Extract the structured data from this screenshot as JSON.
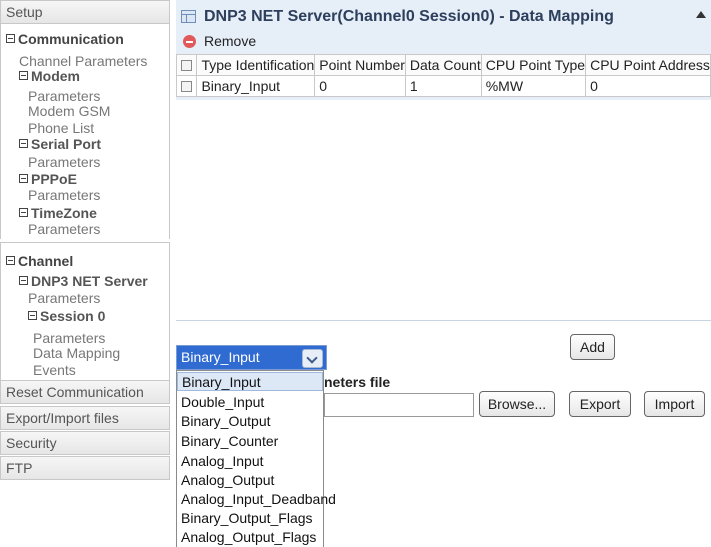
{
  "sidebar": {
    "setup": "Setup",
    "communication": {
      "title": "Communication",
      "channel_parameters": "Channel Parameters",
      "modem": "Modem",
      "modem_items": [
        "Parameters",
        "Modem GSM",
        "Phone List"
      ],
      "serial_port": "Serial Port",
      "serial_items": [
        "Parameters"
      ],
      "pppoe": "PPPoE",
      "pppoe_items": [
        "Parameters"
      ],
      "timezone": "TimeZone",
      "timezone_items": [
        "Parameters"
      ]
    },
    "channel": {
      "title": "Channel",
      "dnp3": "DNP3 NET Server",
      "dnp3_items": [
        "Parameters"
      ],
      "session": "Session 0",
      "session_items": [
        "Parameters",
        "Data Mapping",
        "Events"
      ]
    },
    "bottom": [
      "Reset Communication",
      "Export/Import files",
      "Security",
      "FTP"
    ]
  },
  "main": {
    "title": "DNP3 NET Server(Channel0 Session0) - Data Mapping",
    "remove": "Remove",
    "columns": [
      "Type Identification",
      "Point Number",
      "Data Count",
      "CPU Point Type",
      "CPU Point Address"
    ],
    "rows": [
      [
        "Binary_Input",
        "0",
        "1",
        "%MW",
        "0"
      ]
    ]
  },
  "controls": {
    "type_select": "Binary_Input",
    "add": "Add",
    "params_file_label": "neters file",
    "browse": "Browse...",
    "export": "Export",
    "import": "Import",
    "options": [
      "Binary_Input",
      "Double_Input",
      "Binary_Output",
      "Binary_Counter",
      "Analog_Input",
      "Analog_Output",
      "Analog_Input_Deadband",
      "Binary_Output_Flags",
      "Analog_Output_Flags"
    ]
  },
  "colors": {
    "selection": "#2f6bd1",
    "panel_bg": "#e6eef8",
    "remove_icon": "#e05a5a"
  }
}
